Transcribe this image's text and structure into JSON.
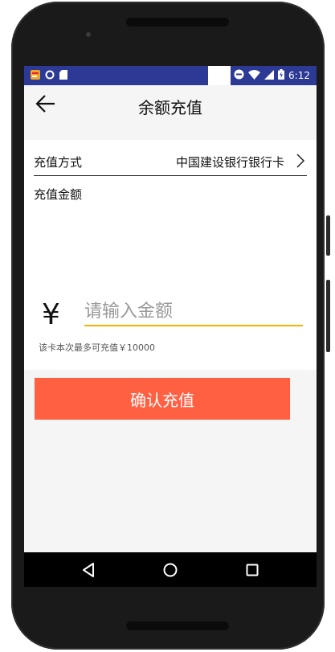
{
  "status_bar": {
    "time": "6:12",
    "icons": [
      "notification-app-icon",
      "circle-icon",
      "sd-card-icon",
      "do-not-disturb-icon",
      "wifi-icon",
      "signal-icon",
      "battery-icon"
    ]
  },
  "app_bar": {
    "title": "余额充值",
    "back_icon": "back-arrow-icon"
  },
  "form": {
    "payment_method_label": "充值方式",
    "payment_method_value": "中国建设银行银行卡",
    "amount_label": "充值金额",
    "currency_symbol": "¥",
    "amount_placeholder": "请输入金额",
    "amount_value": "",
    "limit_text": "该卡本次最多可充值￥10000"
  },
  "actions": {
    "confirm_label": "确认充值"
  },
  "nav_bar": {
    "buttons": [
      "back-triangle-icon",
      "home-circle-icon",
      "recents-square-icon"
    ]
  },
  "colors": {
    "status_bar": "#2c3a95",
    "confirm_button": "#ff6042",
    "input_underline": "#f0b400",
    "background": "#f5f5f5"
  }
}
